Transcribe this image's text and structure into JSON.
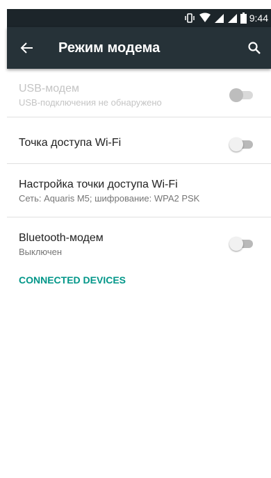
{
  "status_bar": {
    "time": "9:44"
  },
  "app_bar": {
    "title": "Режим модема",
    "back_icon": "arrow-back-icon",
    "search_icon": "search-icon"
  },
  "items": [
    {
      "title": "USB-модем",
      "subtitle": "USB-подключения не обнаружено",
      "switch_on": false,
      "enabled": false
    },
    {
      "title": "Точка доступа Wi-Fi",
      "switch_on": false,
      "enabled": true
    },
    {
      "title": "Настройка точки доступа Wi-Fi",
      "subtitle": "Сеть: Aquaris M5; шифрование: WPA2 PSK",
      "enabled": true
    },
    {
      "title": "Bluetooth-модем",
      "subtitle": "Выключен",
      "switch_on": false,
      "enabled": true
    }
  ],
  "section_header": "CONNECTED DEVICES",
  "colors": {
    "app_bar": "#263238",
    "status_bar": "#1c252a",
    "accent": "#009688"
  }
}
